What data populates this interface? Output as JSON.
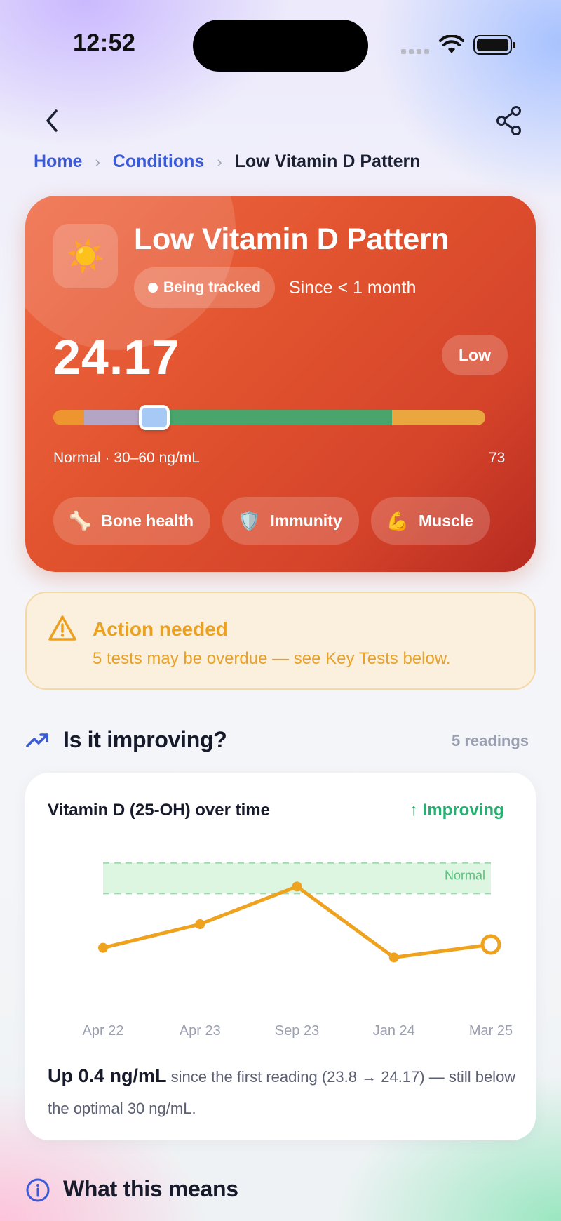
{
  "status_bar": {
    "time": "12:52"
  },
  "breadcrumb": {
    "home": "Home",
    "conditions": "Conditions",
    "current": "Low Vitamin D Pattern"
  },
  "hero": {
    "icon": "☀️",
    "title": "Low Vitamin D Pattern",
    "tracking_status": "Being tracked",
    "since": "Since < 1 month",
    "value": "24.17",
    "level_badge": "Low",
    "range_label": "Normal · 30–60 ng/mL",
    "range_max": "73",
    "tags": [
      {
        "emoji": "🦴",
        "label": "Bone health"
      },
      {
        "emoji": "🛡️",
        "label": "Immunity"
      },
      {
        "emoji": "💪",
        "label": "Muscle"
      }
    ]
  },
  "alert": {
    "title": "Action needed",
    "message": "5 tests may be overdue — see Key Tests below."
  },
  "improving_section": {
    "title": "Is it improving?",
    "readings_count": "5 readings"
  },
  "chart_card": {
    "title": "Vitamin D (25-OH) over time",
    "trend": "↑ Improving",
    "summary_strong": "Up 0.4 ng/mL",
    "summary_rest": " since the first reading (23.8 → 24.17) — still below the optimal 30 ng/mL."
  },
  "chart_data": {
    "type": "line",
    "categories": [
      "Apr 22",
      "Apr 23",
      "Sep 23",
      "Jan 24",
      "Mar 25"
    ],
    "series": [
      {
        "values": [
          23.8,
          26.5,
          30.8,
          22.7,
          24.17
        ]
      }
    ],
    "band": {
      "label": "Normal",
      "from": 30,
      "to": 33.5
    },
    "ylim": [
      18,
      35
    ],
    "grid": false
  },
  "what_section": {
    "title": "What this means"
  },
  "colors": {
    "hero_gradient": [
      "#ef6a45",
      "#b62a20"
    ],
    "link": "#3b5bd9",
    "warning": "#eca020",
    "improving": "#23b071",
    "series_line": "#eea21e",
    "band_fill": "#dcf6e2"
  },
  "icons": {
    "back": "chevron-left-icon",
    "share": "share-icon",
    "alert": "warning-triangle-icon",
    "trend": "trending-up-icon",
    "info": "info-circle-icon"
  }
}
